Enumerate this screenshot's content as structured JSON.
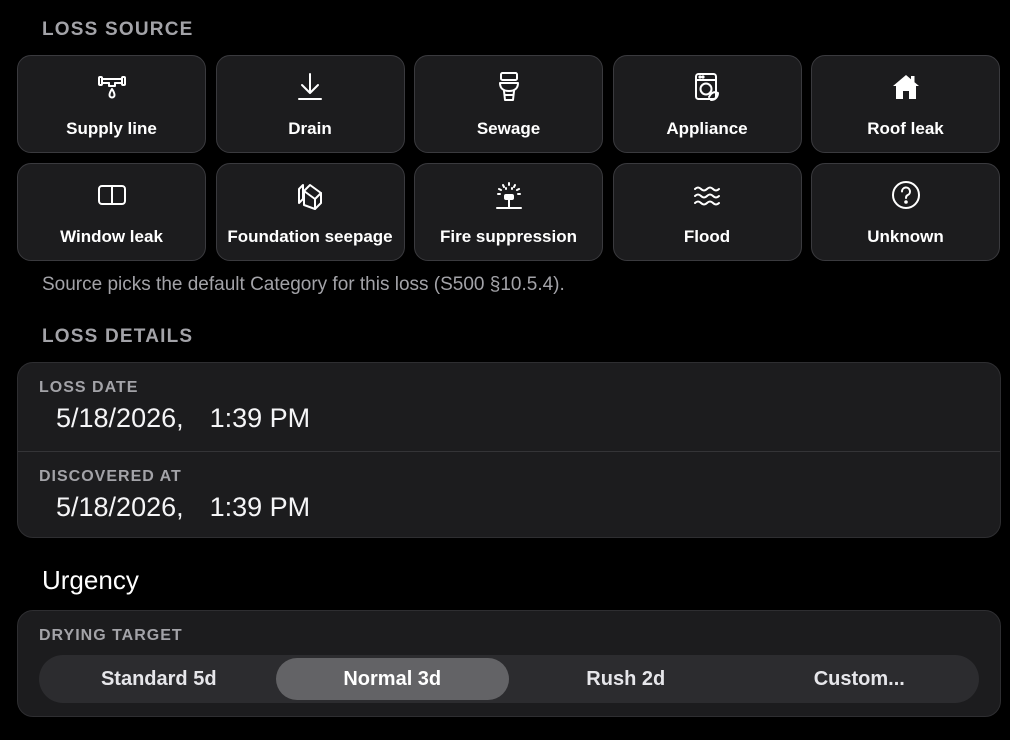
{
  "loss_source": {
    "heading": "LOSS SOURCE",
    "options": [
      {
        "label": "Supply line",
        "icon": "pipe-drip-icon"
      },
      {
        "label": "Drain",
        "icon": "arrow-down-to-line-icon"
      },
      {
        "label": "Sewage",
        "icon": "toilet-icon"
      },
      {
        "label": "Appliance",
        "icon": "washing-machine-icon"
      },
      {
        "label": "Roof leak",
        "icon": "house-icon"
      },
      {
        "label": "Window leak",
        "icon": "window-icon"
      },
      {
        "label": "Foundation seepage",
        "icon": "stacked-blocks-icon"
      },
      {
        "label": "Fire suppression",
        "icon": "sprinkler-icon"
      },
      {
        "label": "Flood",
        "icon": "water-waves-icon"
      },
      {
        "label": "Unknown",
        "icon": "question-circle-icon"
      }
    ],
    "hint": "Source picks the default Category for this loss (S500 §10.5.4)."
  },
  "loss_details": {
    "heading": "LOSS DETAILS",
    "loss_date": {
      "label": "LOSS DATE",
      "date": "5/18/2026,",
      "time": "1:39 PM"
    },
    "discovered_at": {
      "label": "DISCOVERED AT",
      "date": "5/18/2026,",
      "time": "1:39 PM"
    }
  },
  "urgency": {
    "title": "Urgency",
    "drying_target_label": "DRYING TARGET",
    "options": [
      "Standard 5d",
      "Normal 3d",
      "Rush 2d",
      "Custom..."
    ],
    "selected": "Normal 3d"
  },
  "colors": {
    "background": "#000000",
    "card": "#1c1c1e",
    "segment_selected": "#636366",
    "secondary_text": "#a3a3a8"
  }
}
